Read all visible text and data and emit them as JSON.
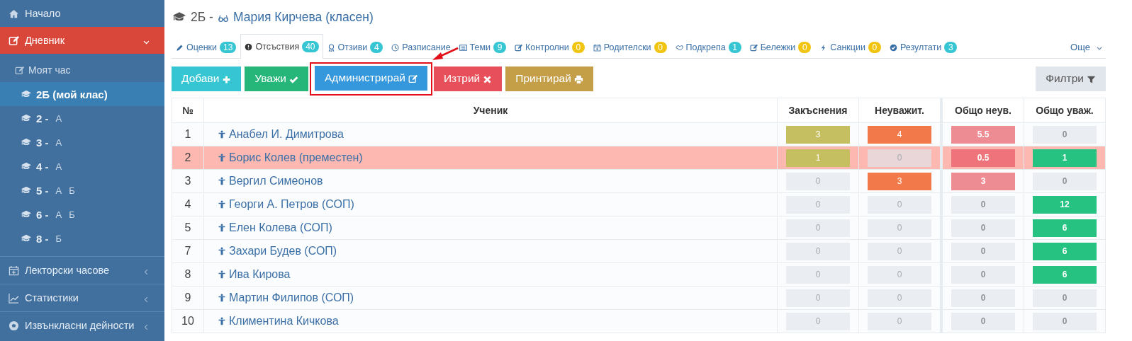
{
  "sidebar": {
    "items": [
      {
        "label": "Начало",
        "kind": "link",
        "selected": false
      },
      {
        "label": "Дневник",
        "kind": "group",
        "selected": true,
        "expanded": true,
        "children": [
          {
            "kind": "link",
            "label": "Моят час",
            "selected": false
          },
          {
            "kind": "class",
            "grade": "2Б (мой клас)",
            "selected": true
          },
          {
            "kind": "class",
            "grade": "2 -",
            "sections": [
              "А"
            ],
            "selected": false
          },
          {
            "kind": "class",
            "grade": "3 -",
            "sections": [
              "А"
            ],
            "selected": false
          },
          {
            "kind": "class",
            "grade": "4 -",
            "sections": [
              "А"
            ],
            "selected": false
          },
          {
            "kind": "class",
            "grade": "5 -",
            "sections": [
              "А",
              "Б"
            ],
            "selected": false
          },
          {
            "kind": "class",
            "grade": "6 -",
            "sections": [
              "А",
              "Б"
            ],
            "selected": false
          },
          {
            "kind": "class",
            "grade": "8 -",
            "sections": [
              "Б"
            ],
            "selected": false
          }
        ]
      },
      {
        "label": "Лекторски часове",
        "kind": "group",
        "selected": false,
        "expanded": false
      },
      {
        "label": "Статистики",
        "kind": "group",
        "selected": false,
        "expanded": false
      },
      {
        "label": "Извънкласни дейности",
        "kind": "group",
        "selected": false,
        "expanded": false
      }
    ]
  },
  "header": {
    "class": "2Б -",
    "teacher": "Мария Кирчева (класен)"
  },
  "tabs": [
    {
      "label": "Оценки",
      "count": "13",
      "color": "#36c6d3",
      "selected": false
    },
    {
      "label": "Отсъствия",
      "count": "40",
      "color": "#36c6d3",
      "selected": true
    },
    {
      "label": "Отзиви",
      "count": "4",
      "color": "#36c6d3",
      "selected": false
    },
    {
      "label": "Разписание",
      "selected": false
    },
    {
      "label": "Теми",
      "count": "9",
      "color": "#36c6d3",
      "selected": false
    },
    {
      "label": "Контролни",
      "count": "0",
      "color": "#f1c40f",
      "selected": false
    },
    {
      "label": "Родителски",
      "count": "0",
      "color": "#f1c40f",
      "selected": false
    },
    {
      "label": "Подкрепа",
      "count": "1",
      "color": "#36c6d3",
      "selected": false
    },
    {
      "label": "Бележки",
      "count": "0",
      "color": "#f1c40f",
      "selected": false
    },
    {
      "label": "Санкции",
      "count": "0",
      "color": "#f1c40f",
      "selected": false
    },
    {
      "label": "Резултати",
      "count": "3",
      "color": "#36c6d3",
      "selected": false
    }
  ],
  "more": "Още",
  "toolbar": {
    "buttons": [
      {
        "label": "Добави",
        "color": "#36c6d3",
        "highlighted": false
      },
      {
        "label": "Уважи",
        "color": "#26b67a",
        "highlighted": false
      },
      {
        "label": "Администрирай",
        "color": "#3598dc",
        "highlighted": true
      },
      {
        "label": "Изтрий",
        "color": "#e7505a",
        "highlighted": false
      },
      {
        "label": "Принтирай",
        "color": "#c49f47",
        "highlighted": false
      }
    ],
    "filter": "Филтри"
  },
  "table": {
    "columns": [
      "№",
      "Ученик",
      "Закъснения",
      "Неуважит.",
      "Общо неув.",
      "Общо уваж."
    ],
    "rows": [
      {
        "highlighted": false,
        "cells": [
          {
            "kind": "number",
            "value": "1"
          },
          {
            "kind": "student",
            "value": "Анабел И. Димитрова"
          },
          {
            "kind": "count",
            "value": "3",
            "color": "#c5bf62"
          },
          {
            "kind": "count",
            "value": "4",
            "color": "#f1794a"
          },
          {
            "kind": "count",
            "value": "5.5",
            "color": "#ee8c94"
          },
          {
            "kind": "count",
            "value": "0",
            "color": "#eaedf2"
          }
        ]
      },
      {
        "highlighted": true,
        "cells": [
          {
            "kind": "number",
            "value": "2"
          },
          {
            "kind": "student",
            "value": "Борис Колев (преместен)"
          },
          {
            "kind": "count",
            "value": "1",
            "color": "#c5bf62"
          },
          {
            "kind": "count",
            "value": "0",
            "color": "#e8d6d8"
          },
          {
            "kind": "count",
            "value": "0.5",
            "color": "#ef737a"
          },
          {
            "kind": "count",
            "value": "1",
            "color": "#26c281"
          }
        ]
      },
      {
        "highlighted": false,
        "cells": [
          {
            "kind": "number",
            "value": "3"
          },
          {
            "kind": "student",
            "value": "Вергил Симеонов"
          },
          {
            "kind": "count",
            "value": "0",
            "color": "#eaedf2"
          },
          {
            "kind": "count",
            "value": "3",
            "color": "#f1794a"
          },
          {
            "kind": "count",
            "value": "3",
            "color": "#ee8c94"
          },
          {
            "kind": "count",
            "value": "0",
            "color": "#eaedf2"
          }
        ]
      },
      {
        "highlighted": false,
        "cells": [
          {
            "kind": "number",
            "value": "4"
          },
          {
            "kind": "student",
            "value": "Георги А. Петров (СОП)"
          },
          {
            "kind": "count",
            "value": "0",
            "color": "#eaedf2"
          },
          {
            "kind": "count",
            "value": "0",
            "color": "#eaedf2"
          },
          {
            "kind": "count",
            "value": "0",
            "color": "#eaedf2"
          },
          {
            "kind": "count",
            "value": "12",
            "color": "#26c281"
          }
        ]
      },
      {
        "highlighted": false,
        "cells": [
          {
            "kind": "number",
            "value": "5"
          },
          {
            "kind": "student",
            "value": "Елен Колева (СОП)"
          },
          {
            "kind": "count",
            "value": "0",
            "color": "#eaedf2"
          },
          {
            "kind": "count",
            "value": "0",
            "color": "#eaedf2"
          },
          {
            "kind": "count",
            "value": "0",
            "color": "#eaedf2"
          },
          {
            "kind": "count",
            "value": "6",
            "color": "#26c281"
          }
        ]
      },
      {
        "highlighted": false,
        "cells": [
          {
            "kind": "number",
            "value": "7"
          },
          {
            "kind": "student",
            "value": "Захари Будев (СОП)"
          },
          {
            "kind": "count",
            "value": "0",
            "color": "#eaedf2"
          },
          {
            "kind": "count",
            "value": "0",
            "color": "#eaedf2"
          },
          {
            "kind": "count",
            "value": "0",
            "color": "#eaedf2"
          },
          {
            "kind": "count",
            "value": "6",
            "color": "#26c281"
          }
        ]
      },
      {
        "highlighted": false,
        "cells": [
          {
            "kind": "number",
            "value": "8"
          },
          {
            "kind": "student",
            "value": "Ива Кирова"
          },
          {
            "kind": "count",
            "value": "0",
            "color": "#eaedf2"
          },
          {
            "kind": "count",
            "value": "0",
            "color": "#eaedf2"
          },
          {
            "kind": "count",
            "value": "0",
            "color": "#eaedf2"
          },
          {
            "kind": "count",
            "value": "6",
            "color": "#26c281"
          }
        ]
      },
      {
        "highlighted": false,
        "cells": [
          {
            "kind": "number",
            "value": "9"
          },
          {
            "kind": "student",
            "value": "Мартин Филипов (СОП)"
          },
          {
            "kind": "count",
            "value": "0",
            "color": "#eaedf2"
          },
          {
            "kind": "count",
            "value": "0",
            "color": "#eaedf2"
          },
          {
            "kind": "count",
            "value": "0",
            "color": "#eaedf2"
          },
          {
            "kind": "count",
            "value": "0",
            "color": "#eaedf2"
          }
        ]
      },
      {
        "highlighted": false,
        "cells": [
          {
            "kind": "number",
            "value": "10"
          },
          {
            "kind": "student",
            "value": "Климентина Кичкова"
          },
          {
            "kind": "count",
            "value": "0",
            "color": "#eaedf2"
          },
          {
            "kind": "count",
            "value": "0",
            "color": "#eaedf2"
          },
          {
            "kind": "count",
            "value": "0",
            "color": "#eaedf2"
          },
          {
            "kind": "count",
            "value": "0",
            "color": "#eaedf2"
          }
        ]
      }
    ]
  }
}
